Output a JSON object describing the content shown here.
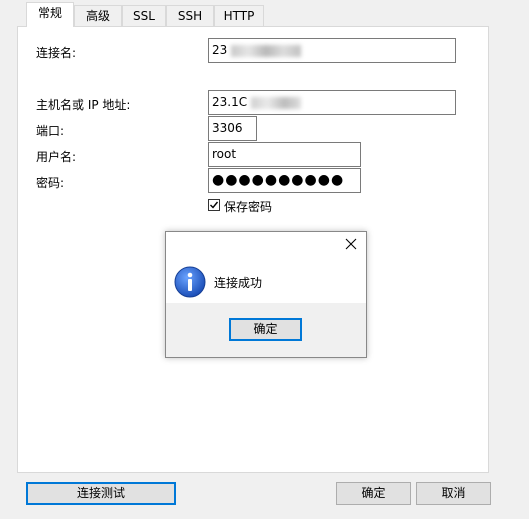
{
  "tabs": [
    {
      "label": "常规"
    },
    {
      "label": "高级"
    },
    {
      "label": "SSL"
    },
    {
      "label": "SSH"
    },
    {
      "label": "HTTP"
    }
  ],
  "form": {
    "connection_name_label": "连接名:",
    "connection_name_value": "23",
    "host_label": "主机名或 IP 地址:",
    "host_value": "23.1C",
    "port_label": "端口:",
    "port_value": "3306",
    "username_label": "用户名:",
    "username_value": "root",
    "password_label": "密码:",
    "password_value": "●●●●●●●●●●",
    "save_password_label": "保存密码",
    "save_password_checked": true
  },
  "dialog": {
    "message": "连接成功",
    "ok_label": "确定"
  },
  "footer": {
    "test_connection_label": "连接测试",
    "ok_label": "确定",
    "cancel_label": "取消"
  },
  "colors": {
    "focus_border": "#0078d7",
    "info_icon": "#1f5fc4"
  }
}
